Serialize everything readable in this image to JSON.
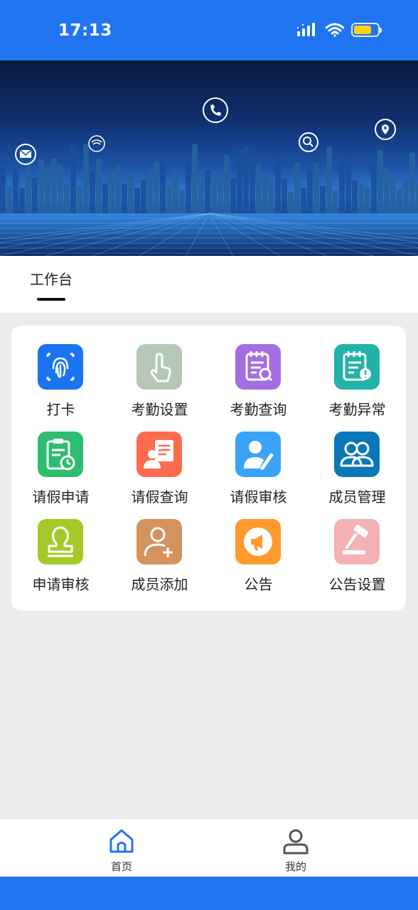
{
  "status_bar": {
    "time": "17:13",
    "battery_level": 0.6
  },
  "tab": {
    "label": "工作台"
  },
  "grid": [
    {
      "label": "打卡",
      "icon": "fingerprint-icon",
      "color": "#1a73f0"
    },
    {
      "label": "考勤设置",
      "icon": "tap-hand-icon",
      "color": "#b5c8b8"
    },
    {
      "label": "考勤查询",
      "icon": "calendar-search-icon",
      "color": "#a56de2"
    },
    {
      "label": "考勤异常",
      "icon": "calendar-alert-icon",
      "color": "#22b2a8"
    },
    {
      "label": "请假申请",
      "icon": "clipboard-clock-icon",
      "color": "#2dbd6e"
    },
    {
      "label": "请假查询",
      "icon": "person-board-icon",
      "color": "#ff6b4f"
    },
    {
      "label": "请假审核",
      "icon": "user-pen-icon",
      "color": "#3aa3f5"
    },
    {
      "label": "成员管理",
      "icon": "users-icon",
      "color": "#0a78b8"
    },
    {
      "label": "申请审核",
      "icon": "stamp-icon",
      "color": "#a5c928"
    },
    {
      "label": "成员添加",
      "icon": "add-user-icon",
      "color": "#d4925e"
    },
    {
      "label": "公告",
      "icon": "megaphone-icon",
      "color": "#ff9a2e"
    },
    {
      "label": "公告设置",
      "icon": "gavel-icon",
      "color": "#f3b3b3"
    }
  ],
  "bottom_nav": {
    "home_label": "首页",
    "mine_label": "我的",
    "active_color": "#1f75f0",
    "inactive_color": "#555555"
  }
}
